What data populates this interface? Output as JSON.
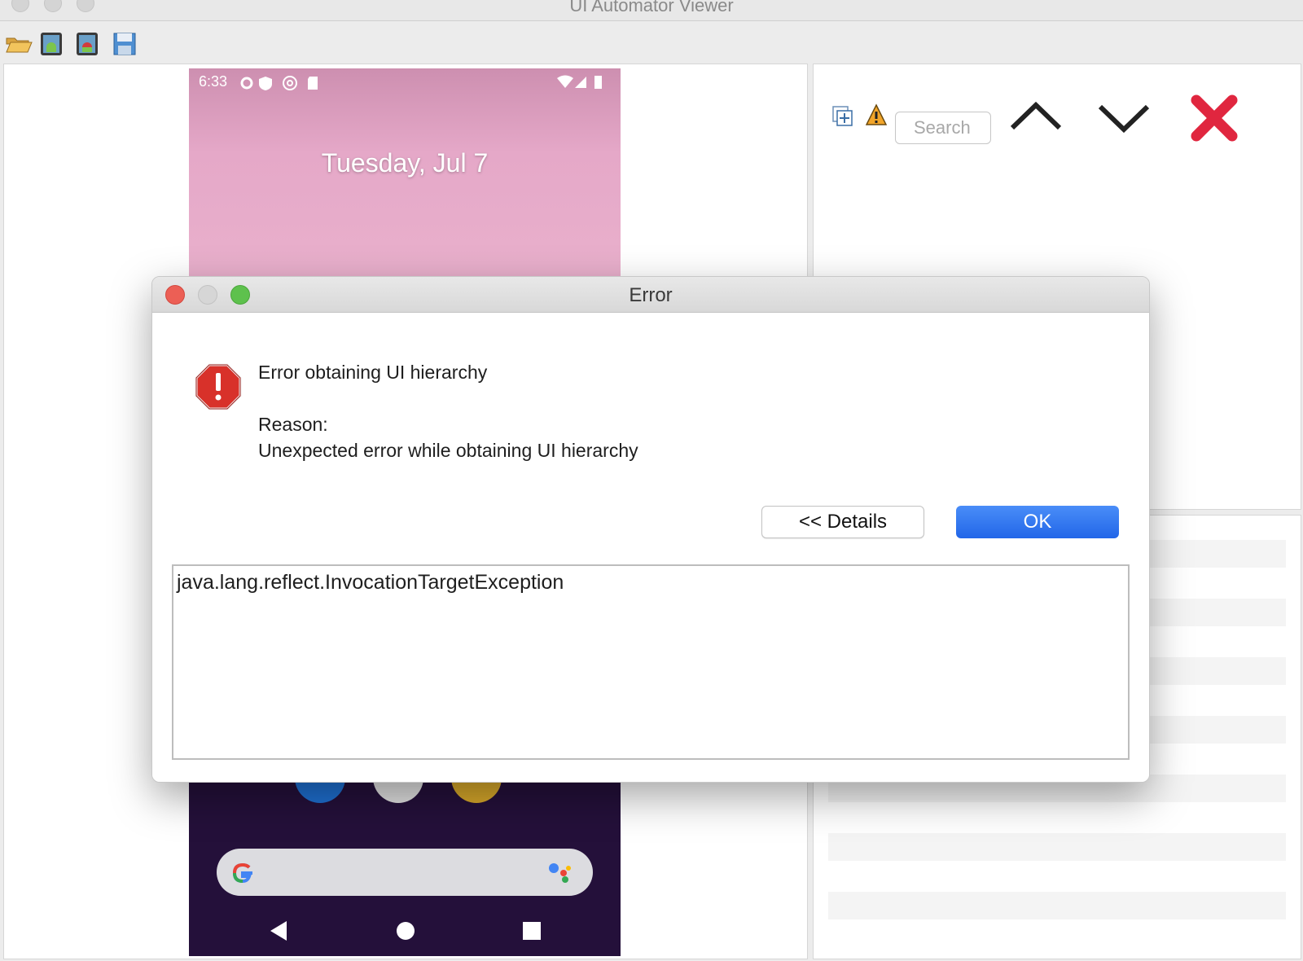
{
  "window": {
    "title": "UI Automator Viewer"
  },
  "toolbar": {
    "items": [
      {
        "icon": "open-folder-icon"
      },
      {
        "icon": "device-screenshot-icon"
      },
      {
        "icon": "device-screenshot-compressed-icon"
      },
      {
        "icon": "save-icon"
      }
    ]
  },
  "device": {
    "status_time": "6:33",
    "lock_date": "Tuesday, Jul 7"
  },
  "right_panel": {
    "search_placeholder": "Search",
    "icons": [
      "expand-all-icon",
      "warning-icon",
      "chevron-up-icon",
      "chevron-down-icon",
      "clear-icon"
    ]
  },
  "dialog": {
    "title": "Error",
    "message": "Error obtaining UI hierarchy",
    "reason_label": "Reason:",
    "reason_text": "Unexpected error while obtaining UI hierarchy",
    "details_button": "<< Details",
    "ok_button": "OK",
    "details_text": "java.lang.reflect.InvocationTargetException"
  },
  "colors": {
    "ok_button": "#2f74ee",
    "close_red": "#ec5f55",
    "zoom_green": "#5ec14d",
    "error_red": "#d8312a",
    "clear_x": "#e0263f"
  }
}
